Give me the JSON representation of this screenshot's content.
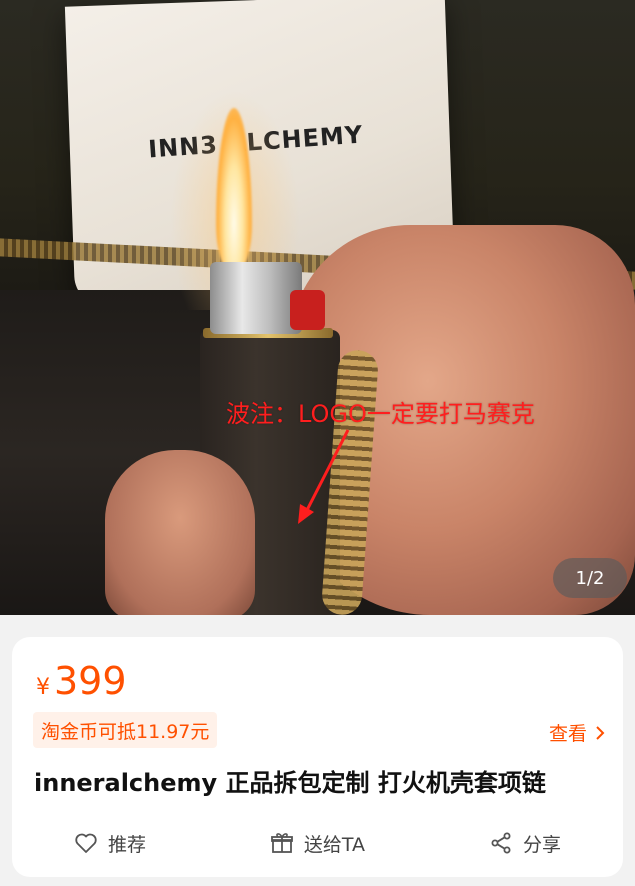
{
  "photo": {
    "dustbag_text": "INN3 ALCHEMY",
    "note": "波注：LOGO一定要打马赛克",
    "page_indicator": "1/2"
  },
  "product": {
    "currency": "¥",
    "price": "399",
    "coin_offer": "淘金币可抵11.97元",
    "view_label": "查看",
    "title": "inneralchemy 正品拆包定制 打火机壳套项链"
  },
  "actions": [
    {
      "label": "推荐",
      "icon": "heart-icon"
    },
    {
      "label": "送给TA",
      "icon": "gift-icon"
    },
    {
      "label": "分享",
      "icon": "share-icon"
    }
  ],
  "colors": {
    "accent": "#ff5000",
    "coin_bg": "#fff1e9",
    "note": "#ff1e1e"
  }
}
